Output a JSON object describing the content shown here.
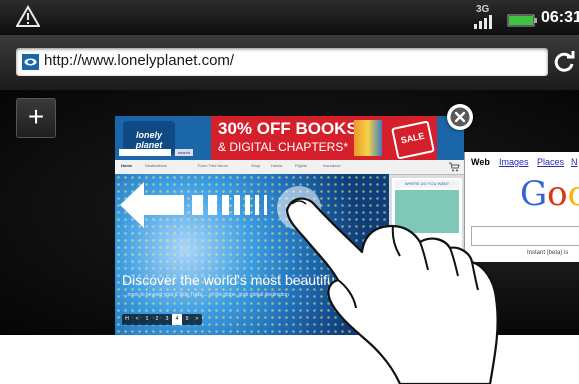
{
  "status_bar": {
    "network_type": "3G",
    "time": "06:31",
    "left_icon": "alert-triangle-icon"
  },
  "browser": {
    "url": "http://www.lonelyplanet.com/",
    "new_tab_label": "+"
  },
  "tabs": {
    "lonely_planet": {
      "logo": "lonely planet",
      "search_button": "search",
      "banner_line1": "30% OFF BOOKS",
      "banner_line2": "& DIGITAL CHAPTERS*",
      "sale_badge": "SALE",
      "nav_items": [
        "Home",
        "Destinations",
        "Thorn Tree forum",
        "Shop",
        "Hotels",
        "Flights",
        "Insurance"
      ],
      "hero_headline": "Discover the world's most beautiful b",
      "hero_subtext": "... more to beyond your d Skip Trails  ...  vil the globe, grab global destination",
      "pager": [
        "H",
        "<",
        "1",
        "2",
        "3",
        "4",
        "5",
        ">"
      ],
      "pager_active": "4",
      "sidebar_heading": "WHERE DO YOU WANT"
    },
    "google": {
      "tab_web": "Web",
      "tab_images": "Images",
      "tab_places": "Places",
      "tab_news": "N",
      "logo_letters": [
        "G",
        "o",
        "o"
      ],
      "logo_colors": [
        "#3366cc",
        "#dd3311",
        "#ffb300"
      ],
      "instant_text": "Instant (beta) is"
    }
  },
  "colors": {
    "lp_blue": "#1b66a8",
    "banner_red": "#d51f2b",
    "battery_green": "#3ec43e"
  }
}
